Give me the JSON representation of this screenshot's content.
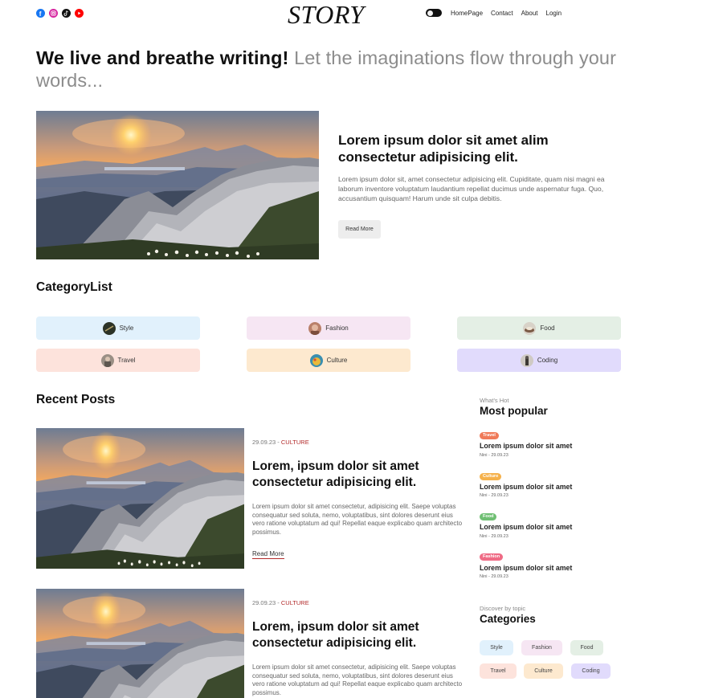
{
  "navbar": {
    "socials": [
      {
        "name": "facebook-icon",
        "color": "#1877f2"
      },
      {
        "name": "instagram-icon",
        "color": "#d6249f"
      },
      {
        "name": "tiktok-icon",
        "color": "#111111"
      },
      {
        "name": "youtube-icon",
        "color": "#ff0000"
      }
    ],
    "logo": "STORY",
    "links": [
      "HomePage",
      "Contact",
      "About",
      "Login"
    ]
  },
  "hero": {
    "bold": "We live and breathe writing!",
    "light": " Let the imaginations flow through your words..."
  },
  "featured": {
    "title": "Lorem ipsum dolor sit amet alim consectetur adipisicing elit.",
    "description": "Lorem ipsum dolor sit, amet consectetur adipisicing elit. Cupiditate, quam nisi magni ea laborum inventore voluptatum laudantium repellat ducimus unde aspernatur fuga. Quo, accusantium quisquam! Harum unde sit culpa debitis.",
    "button": "Read More"
  },
  "category_list": {
    "title": "CategoryList",
    "items": [
      {
        "label": "Style",
        "bg": "#e1f1fc"
      },
      {
        "label": "Fashion",
        "bg": "#f6e6f3"
      },
      {
        "label": "Food",
        "bg": "#e4efe5"
      },
      {
        "label": "Travel",
        "bg": "#fde3dc"
      },
      {
        "label": "Culture",
        "bg": "#fde9cf"
      },
      {
        "label": "Coding",
        "bg": "#e1dbfc"
      }
    ]
  },
  "recent_posts": {
    "title": "Recent Posts",
    "posts": [
      {
        "date": "29.09.23 - ",
        "category": "CULTURE",
        "title": "Lorem, ipsum dolor sit amet consectetur adipisicing elit.",
        "description": "Lorem ipsum dolor sit amet consectetur, adipisicing elit. Saepe voluptas consequatur sed soluta, nemo, voluptatibus, sint dolores deserunt eius vero ratione voluptatum ad qui! Repellat eaque explicabo quam architecto possimus.",
        "link": "Read More"
      },
      {
        "date": "29.09.23 - ",
        "category": "CULTURE",
        "title": "Lorem, ipsum dolor sit amet consectetur adipisicing elit.",
        "description": "Lorem ipsum dolor sit amet consectetur, adipisicing elit. Saepe voluptas consequatur sed soluta, nemo, voluptatibus, sint dolores deserunt eius vero ratione voluptatum ad qui! Repellat eaque explicabo quam architecto possimus."
      }
    ]
  },
  "sidebar": {
    "popular_sub": "What's Hot",
    "popular_title": "Most popular",
    "popular": [
      {
        "tag": "Travel",
        "color": "#f07b59",
        "title": "Lorem ipsum dolor sit amet",
        "meta": "Nini - 29.09.23"
      },
      {
        "tag": "Culture",
        "color": "#f5b14b",
        "title": "Lorem ipsum dolor sit amet",
        "meta": "Nini - 29.09.23"
      },
      {
        "tag": "Food",
        "color": "#6fbf73",
        "title": "Lorem ipsum dolor sit amet",
        "meta": "Nini - 29.09.23"
      },
      {
        "tag": "Fashion",
        "color": "#ef6b85",
        "title": "Lorem ipsum dolor sit amet",
        "meta": "Nini - 29.09.23"
      }
    ],
    "categories_sub": "Discover by topic",
    "categories_title": "Categories",
    "categories": [
      {
        "label": "Style",
        "bg": "#e1f1fc"
      },
      {
        "label": "Fashion",
        "bg": "#f6e6f3"
      },
      {
        "label": "Food",
        "bg": "#e4efe5"
      },
      {
        "label": "Travel",
        "bg": "#fde3dc"
      },
      {
        "label": "Culture",
        "bg": "#fde9cf"
      },
      {
        "label": "Coding",
        "bg": "#e1dbfc"
      }
    ]
  }
}
